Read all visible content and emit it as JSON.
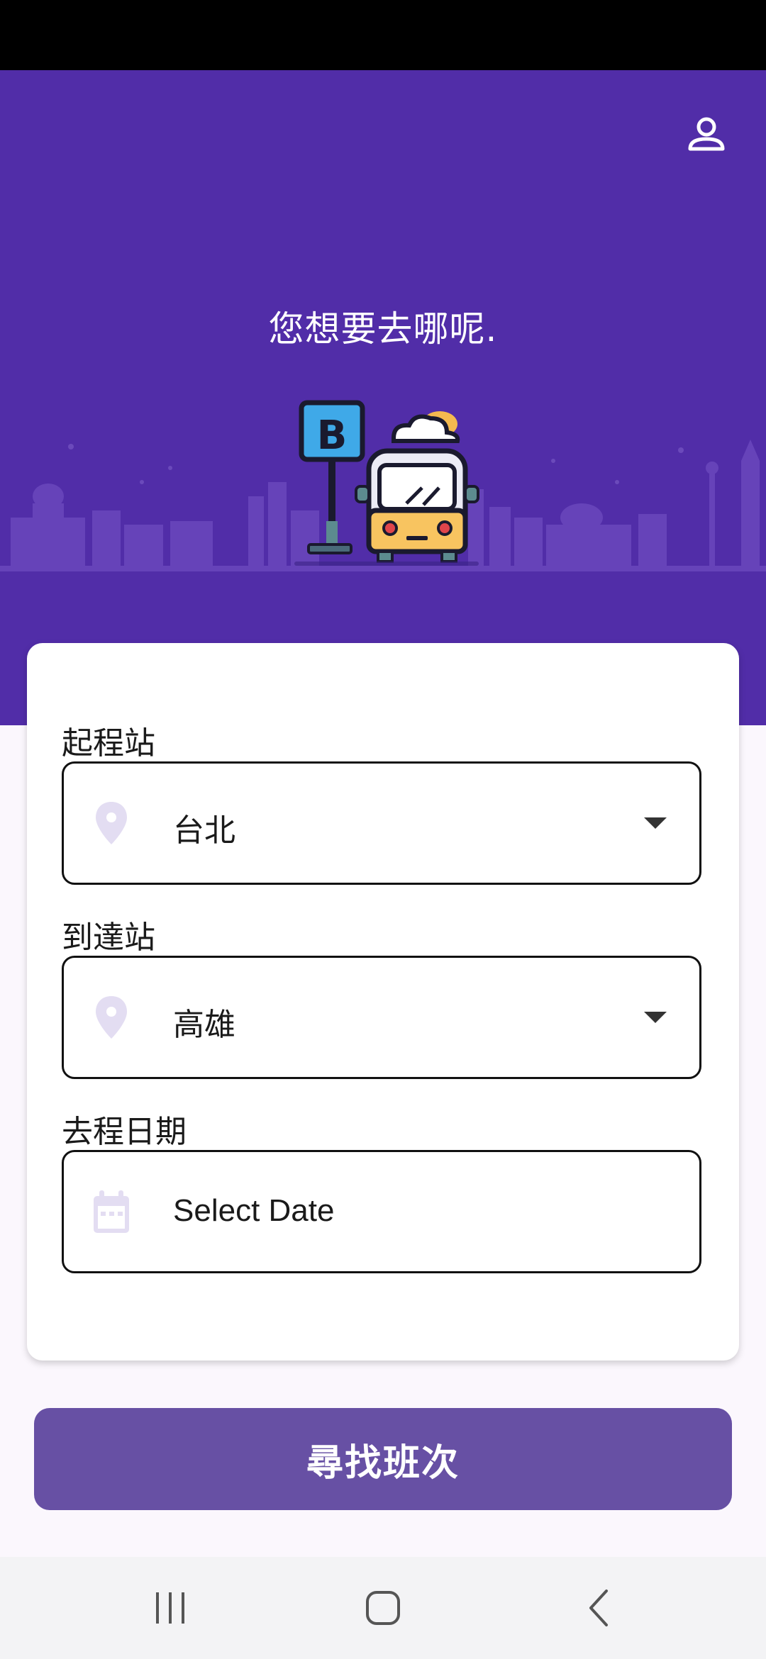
{
  "hero": {
    "title": "您想要去哪呢.",
    "profile_icon": "person-outline-icon",
    "illustration": "bus-stop-illustration",
    "illustration_sign": "B",
    "background_color": "#512da8"
  },
  "form": {
    "departure": {
      "label": "起程站",
      "value": "台北",
      "icon": "location-pin-icon"
    },
    "arrival": {
      "label": "到達站",
      "value": "高雄",
      "icon": "location-pin-icon"
    },
    "date": {
      "label": "去程日期",
      "placeholder": "Select Date",
      "icon": "calendar-icon"
    }
  },
  "search_button": {
    "label": "尋找班次",
    "color": "#6750a4"
  },
  "nav": {
    "recent_icon": "recent-apps-icon",
    "home_icon": "home-icon",
    "back_icon": "back-icon"
  },
  "colors": {
    "accent": "#512da8",
    "icon_tint": "#e3ddf2"
  }
}
